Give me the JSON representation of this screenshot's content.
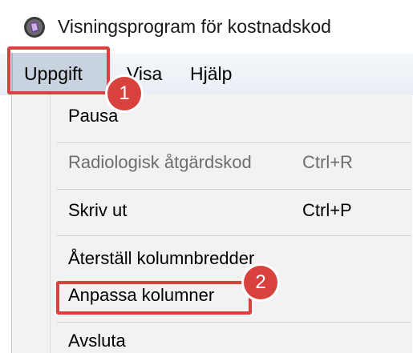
{
  "window": {
    "title": "Visningsprogram för kostnadskod",
    "app_icon": "app-icon"
  },
  "menubar": {
    "items": [
      {
        "label": "Uppgift"
      },
      {
        "label": "Visa"
      },
      {
        "label": "Hjälp"
      }
    ]
  },
  "dropdown": {
    "items": [
      {
        "label": "Pausa",
        "shortcut": "",
        "enabled": true
      },
      {
        "label": "Radiologisk åtgärdskod",
        "shortcut": "Ctrl+R",
        "enabled": false
      },
      {
        "label": "Skriv ut",
        "shortcut": "Ctrl+P",
        "enabled": true
      },
      {
        "label": "Återställ kolumnbredder",
        "shortcut": "",
        "enabled": true
      },
      {
        "label": "Anpassa kolumner",
        "shortcut": "",
        "enabled": true
      },
      {
        "label": "Avsluta",
        "shortcut": "",
        "enabled": true
      }
    ]
  },
  "callouts": [
    {
      "number": "1"
    },
    {
      "number": "2"
    }
  ],
  "colors": {
    "callout": "#d9413f",
    "menu_highlight": "#c9d3df",
    "dropdown_bg": "#f2f2f2",
    "disabled_text": "#6d6d6d"
  }
}
